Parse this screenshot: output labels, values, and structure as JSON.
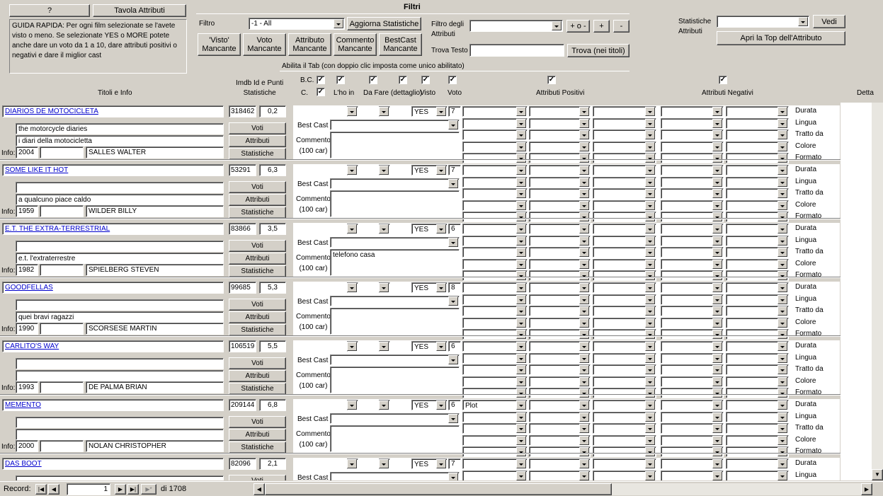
{
  "quick_guide": {
    "help_button": "?",
    "attributes_table_button": "Tavola Attributi",
    "text": "GUIDA RAPIDA: Per ogni film selezionate se l'avete visto o meno. Se selezionate YES o MORE potete anche dare un voto da 1 a 10, dare attributi positivi o negativi e dare il miglior cast"
  },
  "filters": {
    "title": "Filtri",
    "filter_label": "Filtro",
    "filter_value": "-1 - All",
    "update_stats_button": "Aggiorna Statistiche",
    "missing_buttons": [
      "'Visto'\nMancante",
      "Voto\nMancante",
      "Attributo\nMancante",
      "Commento\nMancante",
      "BestCast\nMancante"
    ],
    "attr_filter_label": "Filtro degli\nAttributi",
    "attr_filter_value": "",
    "plus_minus_button": "+ o -",
    "plus_button": "+",
    "minus_button": "-",
    "find_text_label": "Trova Testo",
    "find_text_value": "",
    "find_button": "Trova (nei titoli)",
    "tab_enable_label": "Abilita il Tab (con doppio clic imposta come unico abilitato)"
  },
  "stats": {
    "label": "Statistiche\nAttributi",
    "value": "",
    "view_button": "Vedi",
    "top_button": "Apri la Top dell'Attributo"
  },
  "columns": {
    "titles": "Titoli e Info",
    "imdb": "Imdb Id e Punti\nStatistiche",
    "bc": "B.C.",
    "c": "C.",
    "have": "L'ho in",
    "todo": "Da Fare (dettaglio)",
    "seen": "Visto",
    "vote": "Voto",
    "positive": "Attributi Positivi",
    "negative": "Attributi Negativi",
    "detail": "Detta"
  },
  "record_labels": {
    "info": "Info:",
    "votes_button": "Voti",
    "attributes_button": "Attributi",
    "statistics_button": "Statistiche",
    "best_cast": "Best Cast",
    "comment": "Commento\n(100 car)",
    "props": [
      "Durata",
      "Lingua",
      "Tratto da",
      "Colore",
      "Formato"
    ]
  },
  "records": [
    {
      "title": "DIARIOS DE MOTOCICLETA",
      "line1": "the motorcycle diaries",
      "line2": "i diari della motocicletta",
      "year": "2004",
      "director": "SALLES WALTER",
      "imdb": "318462",
      "points": "0,2",
      "seen": "YES",
      "vote": "7",
      "comment": "",
      "pos1": ""
    },
    {
      "title": "SOME LIKE IT HOT",
      "line1": "",
      "line2": "a qualcuno piace caldo",
      "year": "1959",
      "director": "WILDER BILLY",
      "imdb": "53291",
      "points": "6,3",
      "seen": "YES",
      "vote": "7",
      "comment": "",
      "pos1": ""
    },
    {
      "title": "E.T. THE EXTRA-TERRESTRIAL",
      "line1": "",
      "line2": "e.t. l'extraterrestre",
      "year": "1982",
      "director": "SPIELBERG STEVEN",
      "imdb": "83866",
      "points": "3,5",
      "seen": "YES",
      "vote": "6",
      "comment": "telefono casa",
      "pos1": ""
    },
    {
      "title": "GOODFELLAS",
      "line1": "",
      "line2": "quei bravi ragazzi",
      "year": "1990",
      "director": "SCORSESE MARTIN",
      "imdb": "99685",
      "points": "5,3",
      "seen": "YES",
      "vote": "8",
      "comment": "",
      "pos1": ""
    },
    {
      "title": "CARLITO'S WAY",
      "line1": "",
      "line2": "",
      "year": "1993",
      "director": "DE PALMA BRIAN",
      "imdb": "106519",
      "points": "5,5",
      "seen": "YES",
      "vote": "6",
      "comment": "",
      "pos1": ""
    },
    {
      "title": "MEMENTO",
      "line1": "",
      "line2": "",
      "year": "2000",
      "director": "NOLAN CHRISTOPHER",
      "imdb": "209144",
      "points": "6,8",
      "seen": "YES",
      "vote": "6",
      "comment": "",
      "pos1": "Plot"
    },
    {
      "title": "DAS BOOT",
      "line1": "",
      "line2": "",
      "year": "",
      "director": "",
      "imdb": "82096",
      "points": "2,1",
      "seen": "YES",
      "vote": "7",
      "comment": "",
      "pos1": ""
    }
  ],
  "navigation": {
    "record_label": "Record:",
    "current": "1",
    "total": "di 1708"
  }
}
